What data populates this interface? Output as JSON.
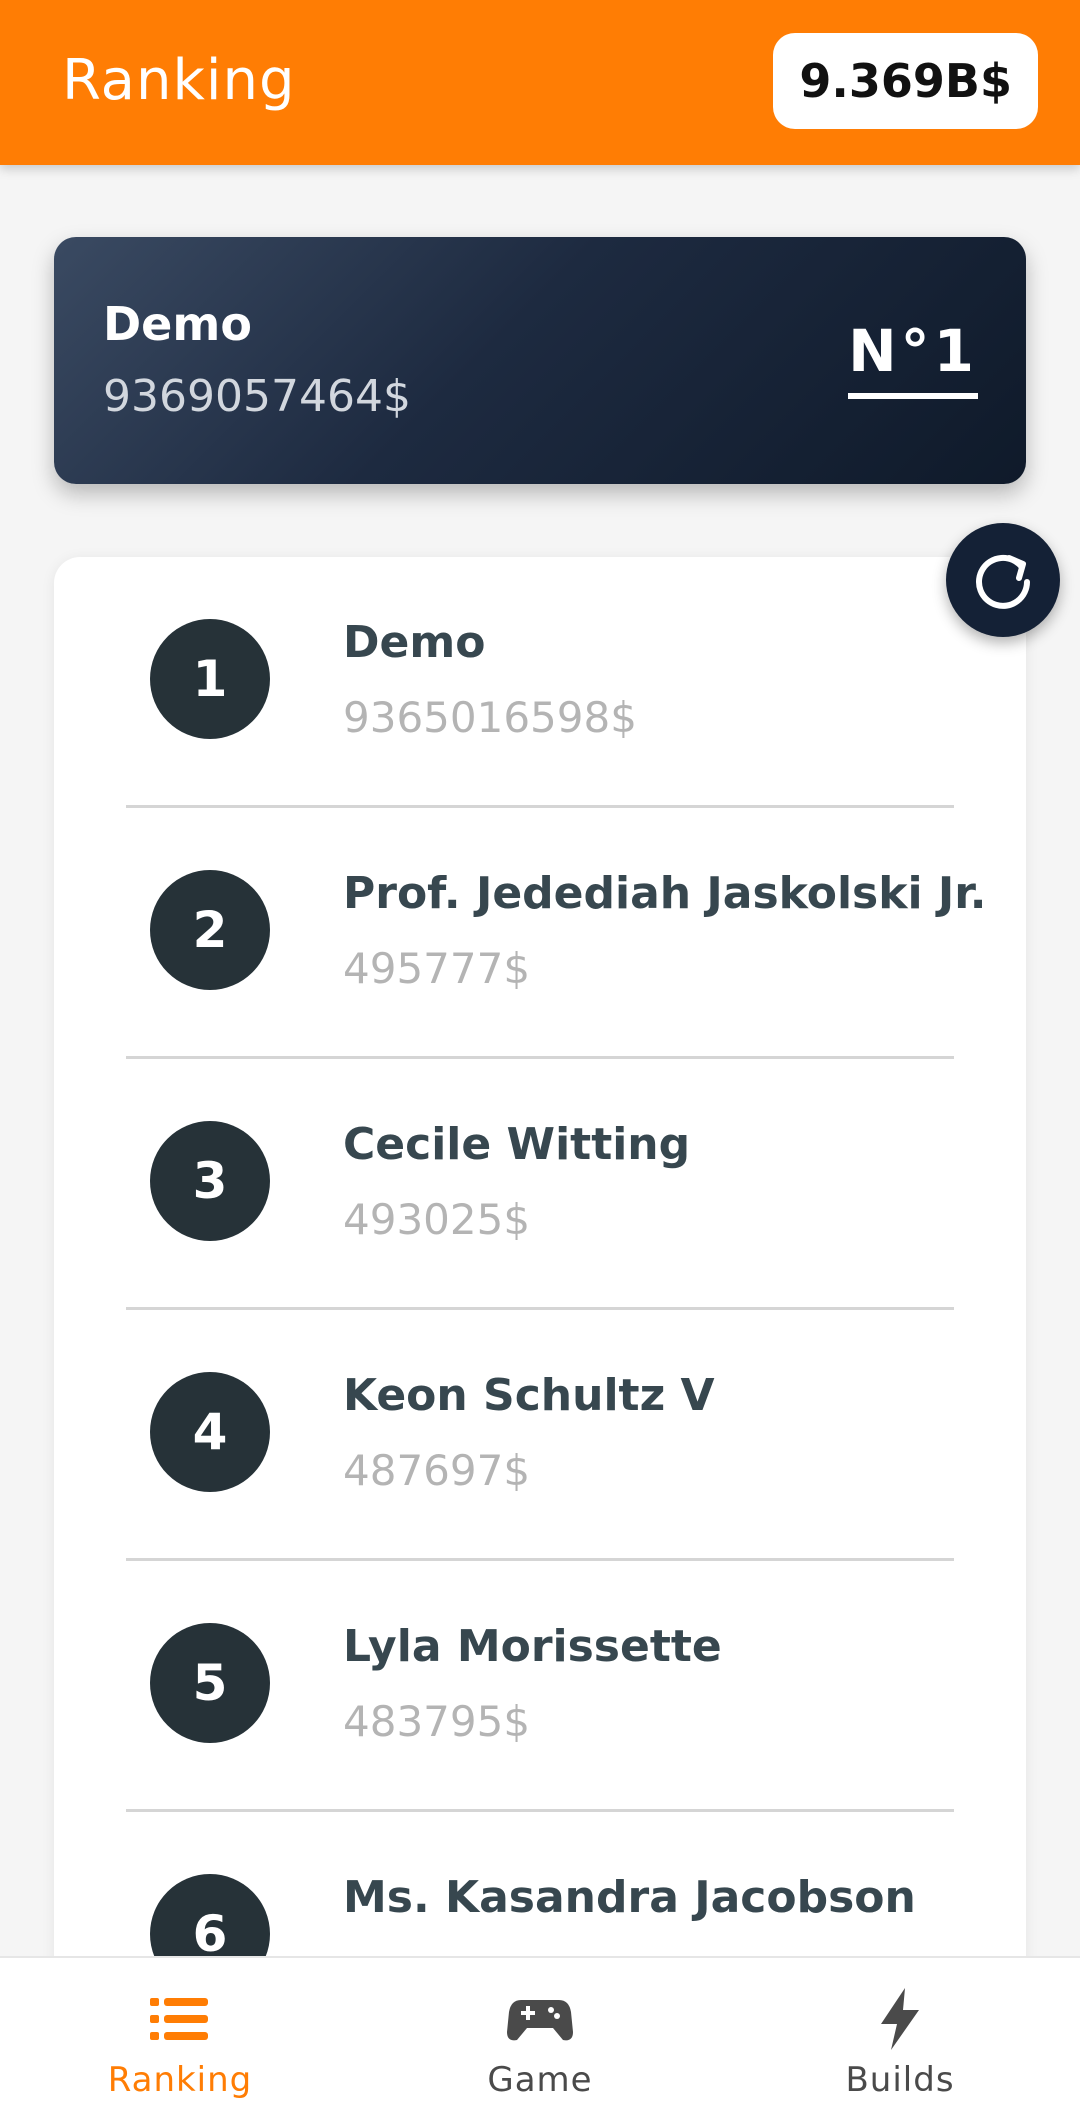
{
  "appbar": {
    "title": "Ranking",
    "balance": "9.369B$"
  },
  "hero": {
    "name": "Demo",
    "amount": "9369057464$",
    "rank": "N°1"
  },
  "ranking": [
    {
      "rank": "1",
      "name": "Demo",
      "amount": "9365016598$"
    },
    {
      "rank": "2",
      "name": "Prof. Jedediah Jaskolski Jr.",
      "amount": "495777$"
    },
    {
      "rank": "3",
      "name": "Cecile Witting",
      "amount": "493025$"
    },
    {
      "rank": "4",
      "name": "Keon Schultz V",
      "amount": "487697$"
    },
    {
      "rank": "5",
      "name": "Lyla Morissette",
      "amount": "483795$"
    },
    {
      "rank": "6",
      "name": "Ms. Kasandra Jacobson",
      "amount": ""
    }
  ],
  "nav": {
    "items": [
      {
        "label": "Ranking",
        "icon": "list-icon",
        "active": true
      },
      {
        "label": "Game",
        "icon": "gamepad-icon",
        "active": false
      },
      {
        "label": "Builds",
        "icon": "lightning-icon",
        "active": false
      }
    ]
  },
  "colors": {
    "accent": "#ff7d04",
    "dark": "#263238",
    "hero_bg": "#1d2a40"
  }
}
